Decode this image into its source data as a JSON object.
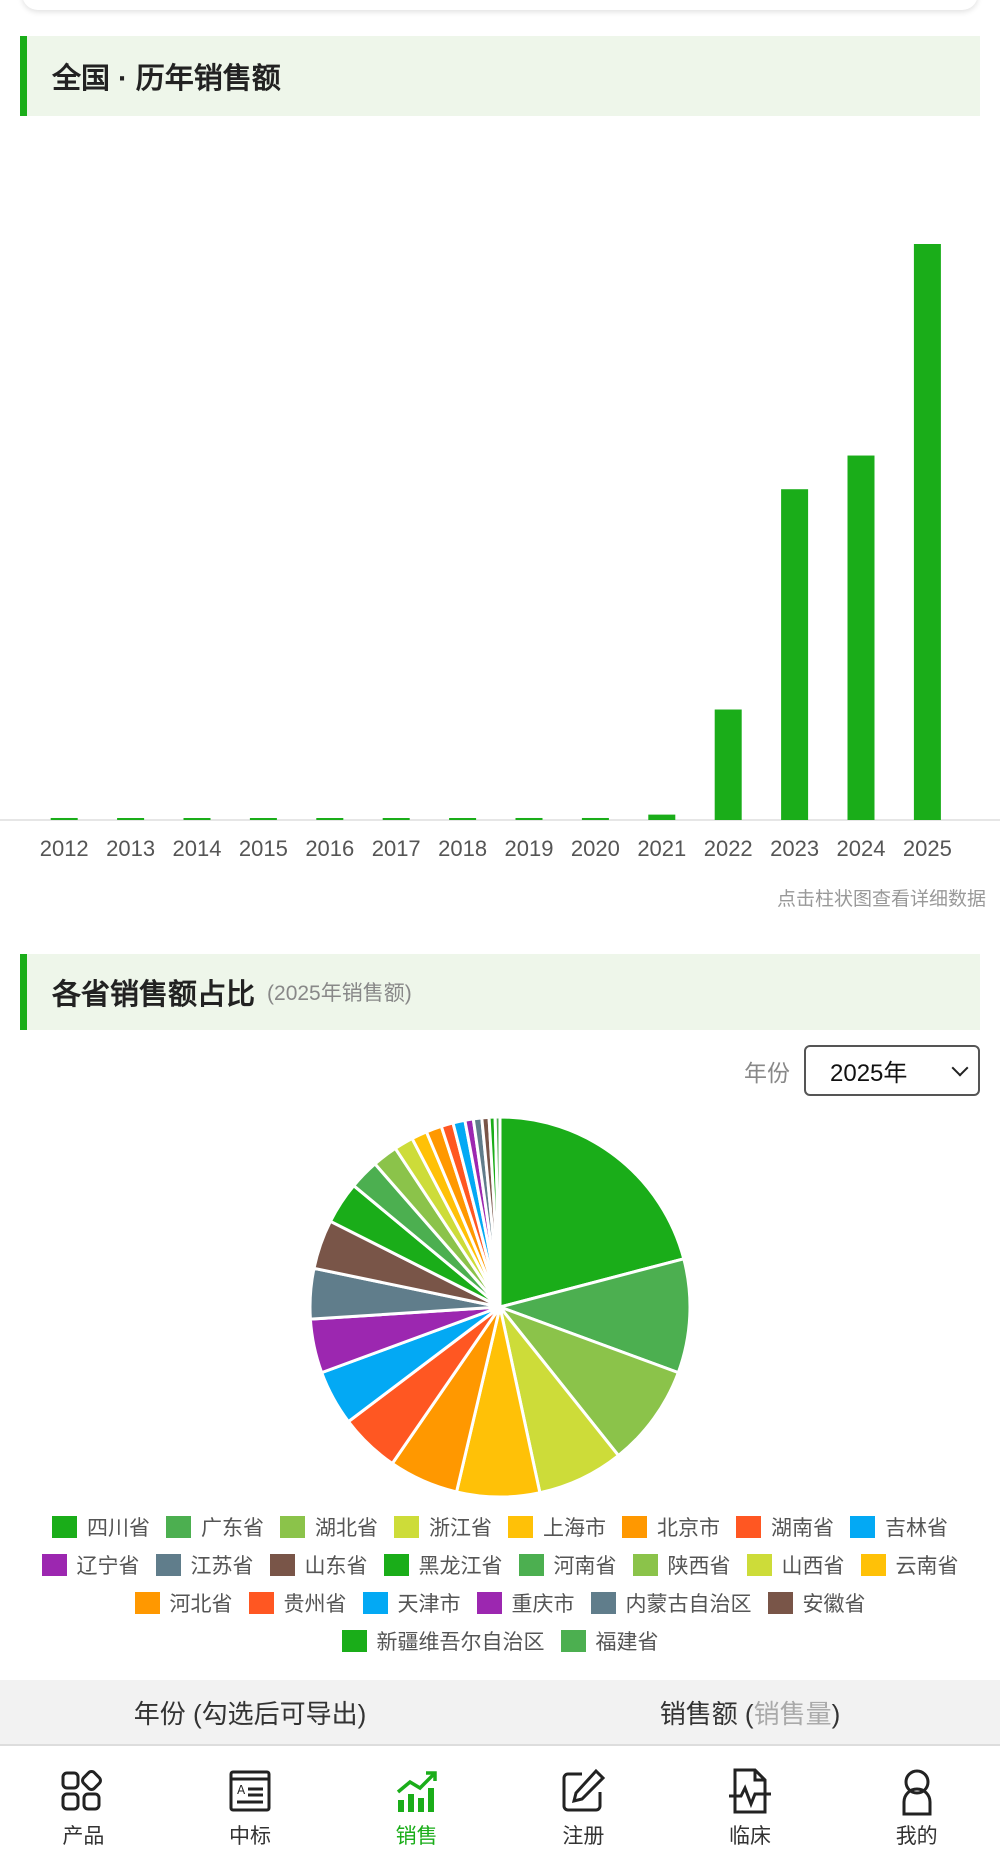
{
  "sections": {
    "national": {
      "title": "全国 · 历年销售额"
    },
    "province": {
      "title": "各省销售额占比",
      "subtitle": "(2025年销售额)"
    }
  },
  "hint": "点击柱状图查看详细数据",
  "year_filter": {
    "label": "年份",
    "selected": "2025年"
  },
  "colors": {
    "accent": "#1aad19",
    "header_bg": "#eef6ea"
  },
  "chart_data": [
    {
      "type": "bar",
      "categories": [
        "2012",
        "2013",
        "2014",
        "2015",
        "2016",
        "2017",
        "2018",
        "2019",
        "2020",
        "2021",
        "2022",
        "2023",
        "2024",
        "2025"
      ],
      "values": [
        0.3,
        0.2,
        0.2,
        0.2,
        0.2,
        0.2,
        0.2,
        0.3,
        0.3,
        0.8,
        16.4,
        49.1,
        54.1,
        85.5
      ],
      "ylim": [
        0,
        95
      ],
      "color": "#1aad19",
      "grid": false
    },
    {
      "type": "pie",
      "categories": [
        "四川省",
        "广东省",
        "湖北省",
        "浙江省",
        "上海市",
        "北京市",
        "湖南省",
        "吉林省",
        "辽宁省",
        "江苏省",
        "山东省",
        "黑龙江省",
        "河南省",
        "陕西省",
        "山西省",
        "云南省",
        "河北省",
        "贵州省",
        "天津市",
        "重庆市",
        "内蒙古自治区",
        "安徽省",
        "新疆维吾尔自治区",
        "福建省"
      ],
      "values": [
        20.5,
        9.5,
        8.5,
        7.2,
        6.9,
        5.8,
        5.0,
        4.6,
        4.5,
        4.2,
        4.1,
        3.5,
        2.5,
        2.1,
        1.6,
        1.3,
        1.3,
        1.0,
        1.0,
        0.7,
        0.7,
        0.6,
        0.5,
        0.4
      ],
      "colors": [
        "#1aad19",
        "#4caf50",
        "#8bc34a",
        "#cddc39",
        "#ffc107",
        "#ff9800",
        "#ff5722",
        "#03a9f4",
        "#9c27b0",
        "#607d8b",
        "#795548",
        "#1aad19",
        "#4caf50",
        "#8bc34a",
        "#cddc39",
        "#ffc107",
        "#ff9800",
        "#ff5722",
        "#03a9f4",
        "#9c27b0",
        "#607d8b",
        "#795548",
        "#1aad19",
        "#4caf50"
      ],
      "legend_position": "bottom"
    }
  ],
  "table": {
    "col1": "年份 (勾选后可导出)",
    "col2_main": "销售额 (",
    "col2_muted": "销售量",
    "col2_end": ")"
  },
  "tabs": [
    {
      "label": "产品",
      "icon": "grid-icon"
    },
    {
      "label": "中标",
      "icon": "document-icon"
    },
    {
      "label": "销售",
      "icon": "chart-icon"
    },
    {
      "label": "注册",
      "icon": "edit-icon"
    },
    {
      "label": "临床",
      "icon": "medical-file-icon"
    },
    {
      "label": "我的",
      "icon": "person-icon"
    }
  ]
}
